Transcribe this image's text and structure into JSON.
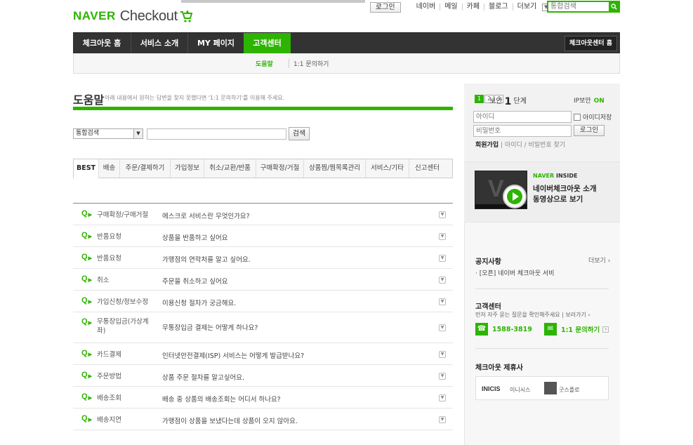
{
  "header": {
    "logo_naver": "NAVER",
    "logo_checkout": "Checkout",
    "util": {
      "login": "로그인",
      "links": [
        "네이버",
        "메일",
        "카페",
        "블로그",
        "더보기"
      ]
    },
    "search_placeholder": "통합검색"
  },
  "gnb": {
    "items": [
      "체크아웃 홈",
      "서비스 소개",
      "MY 페이지",
      "고객센터"
    ],
    "active_index": 3,
    "home_button": "체크아웃센터 홈"
  },
  "subnav": {
    "items": [
      "도움말",
      "1:1 문의하기"
    ],
    "active_index": 0
  },
  "help": {
    "title": "도움말",
    "desc": "아래 내용에서 원하는 답변을 찾지 못했다면 '1:1 문의하기'를 이용해 주세요.",
    "select_value": "통합검색",
    "search_button": "검색"
  },
  "tabs": [
    "BEST",
    "배송",
    "주문/결제하기",
    "가입정보",
    "취소/교환/반품",
    "구매확정/거절",
    "상품찜/찜목록관리",
    "서비스/기타",
    "신고센터"
  ],
  "faq": [
    {
      "cat": "구매확정/구매거절",
      "q": "에스크로 서비스란 무엇인가요?"
    },
    {
      "cat": "반품요청",
      "q": "상품을 반품하고 싶어요"
    },
    {
      "cat": "반품요청",
      "q": "가맹점의 연락처를 알고 싶어요."
    },
    {
      "cat": "취소",
      "q": "주문을 취소하고 싶어요"
    },
    {
      "cat": "가입신청/정보수정",
      "q": "이용신청 절차가 궁금해요."
    },
    {
      "cat": "무통장입금(가상계좌)",
      "q": "무통장입금 결제는 어떻게 하나요?"
    },
    {
      "cat": "카드결제",
      "q": "인터넷안전결제(ISP) 서비스는 어떻게 발급받나요?"
    },
    {
      "cat": "주문방법",
      "q": "상품 주문 절차를 알고싶어요."
    },
    {
      "cat": "배송조회",
      "q": "배송 중 상품의 배송조회는 어디서 하나요?"
    },
    {
      "cat": "배송지연",
      "q": "가맹점이 상품을 보냈다는데 상품이 오지 않아요."
    }
  ],
  "login": {
    "levels": [
      "1",
      "2",
      "3"
    ],
    "security_label": "보안",
    "security_level": "1",
    "security_unit": "단계",
    "ip_label": "IP보안",
    "ip_state": "ON",
    "id_placeholder": "아이디",
    "pw_placeholder": "비밀번호",
    "save_id": "아이디저장",
    "login_button": "로그인",
    "join": "회원가입",
    "find": "아이디 / 비밀번호 찾기"
  },
  "video": {
    "badge_naver": "NAVER",
    "badge_inside": "INSIDE",
    "title_line1": "네이버체크아웃 소개",
    "title_line2": "동영상으로 보기"
  },
  "notice": {
    "title": "공지사항",
    "more": "더보기",
    "items": [
      "· [오픈] 네이버 체크아웃 서비"
    ]
  },
  "cs": {
    "title": "고객센터",
    "desc": "먼저 자주 묻는 질문을 확인해주세요",
    "shortcut": "보러가기",
    "phone": "1588-3819",
    "inquiry": "1:1 문의하기"
  },
  "partners": {
    "title": "체크아웃 제휴사",
    "inicis_logo": "INICIS",
    "inicis_name": "이니시스",
    "goodsflow_name": "굿스플로"
  },
  "colors": {
    "brand_green": "#2db400",
    "gnb_dark": "#333333"
  }
}
